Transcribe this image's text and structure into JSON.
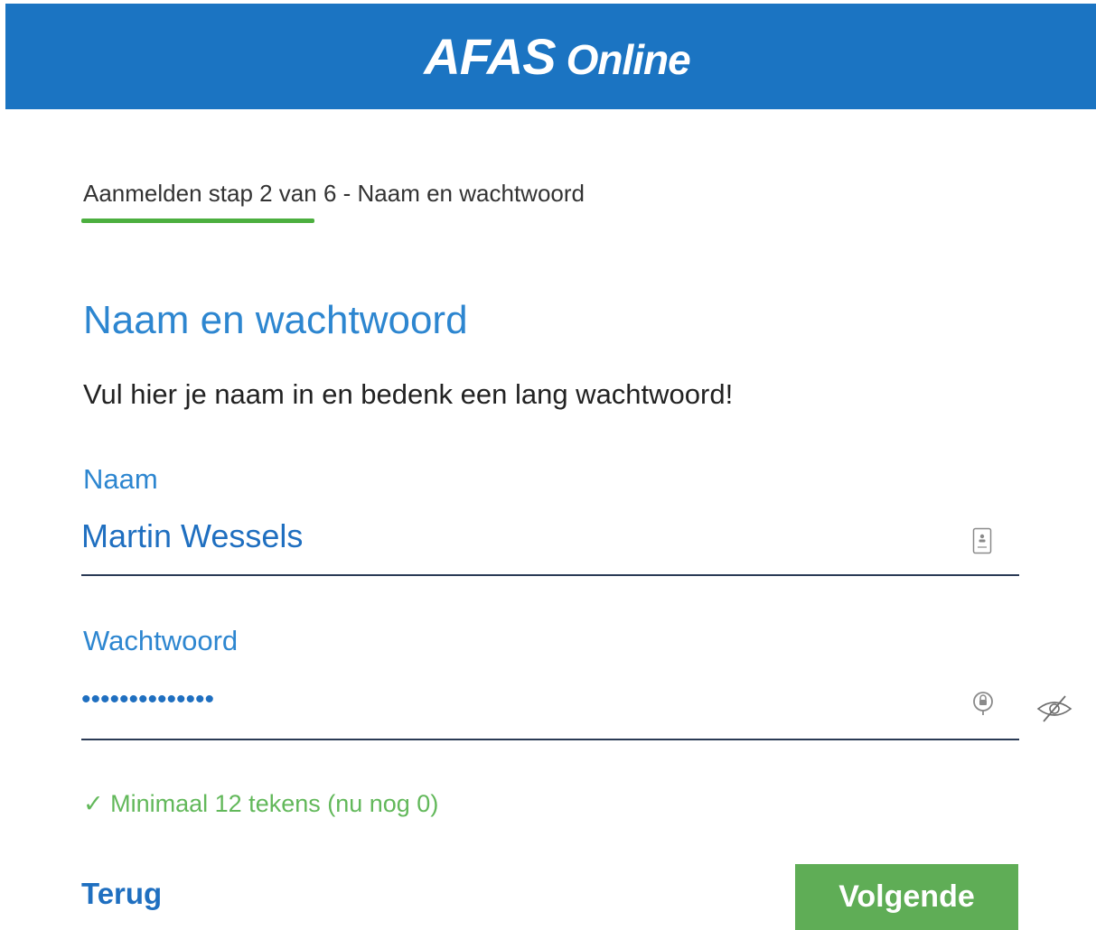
{
  "header": {
    "logo_brand": "AFAS",
    "logo_suffix": "Online",
    "background_color": "#1b74c2"
  },
  "progress": {
    "step_text": "Aanmelden stap 2 van 6 - Naam en wachtwoord",
    "current_step": 2,
    "total_steps": 6,
    "bar_color": "#4caf3f"
  },
  "form": {
    "title": "Naam en wachtwoord",
    "subtitle": "Vul hier je naam in en bedenk een lang wachtwoord!",
    "name_field": {
      "label": "Naam",
      "value": "Martin Wessels",
      "icon": "contact-card-icon"
    },
    "password_field": {
      "label": "Wachtwoord",
      "value": "••••••••••••••",
      "icon": "keychain-icon",
      "toggle_icon": "eye-slash-icon"
    },
    "hint": "✓ Minimaal 12 tekens (nu nog 0)",
    "hint_color": "#62b85a"
  },
  "actions": {
    "back_label": "Terug",
    "next_label": "Volgende",
    "next_color": "#5fad56"
  }
}
